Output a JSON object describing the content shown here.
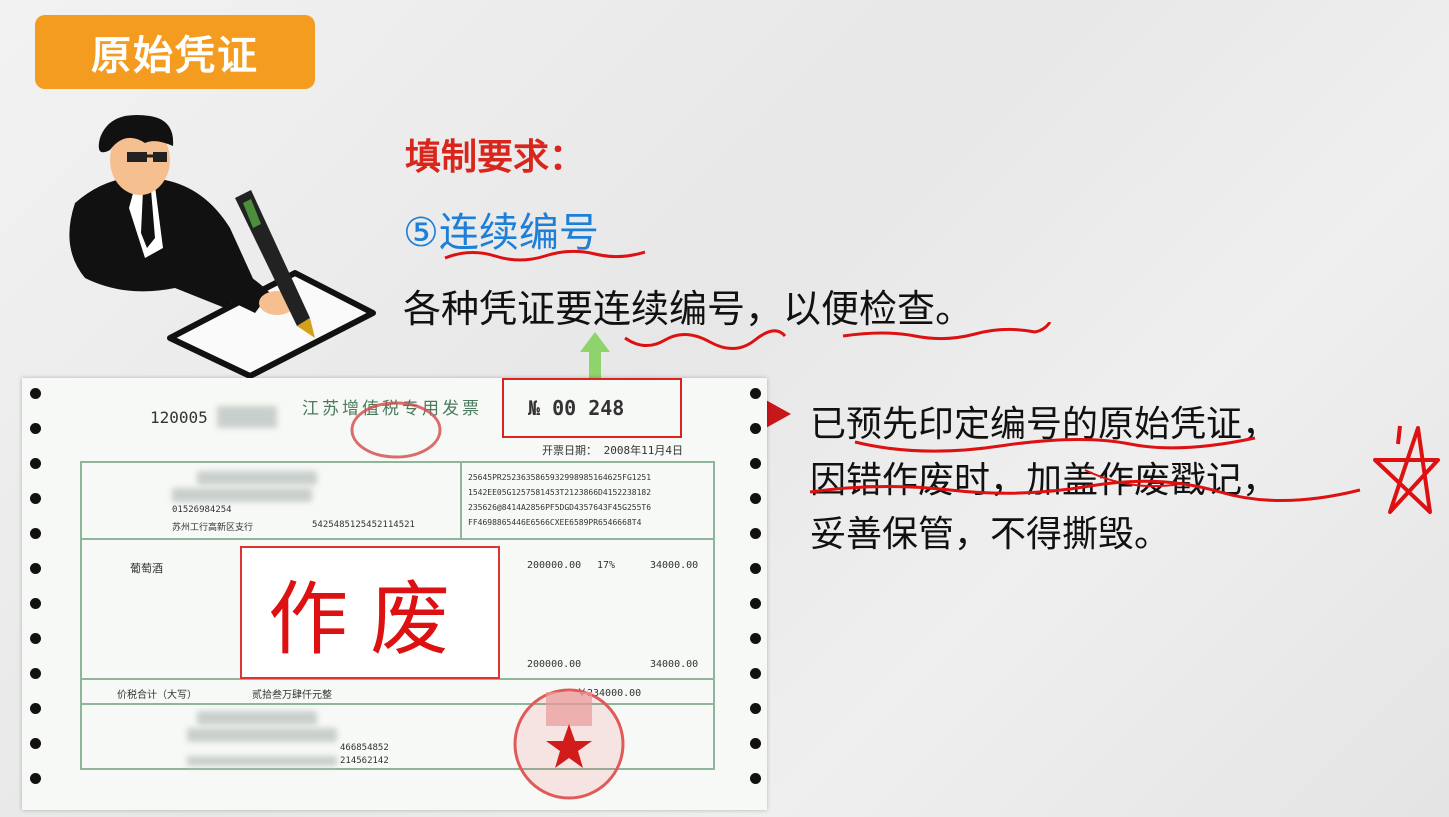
{
  "badge": {
    "label": "原始凭证"
  },
  "requirements": {
    "heading": "填制要求：",
    "item_number": "⑤",
    "item_title": "连续编号",
    "sentence_a": "各种凭证要",
    "sentence_b": "连续编号",
    "sentence_c": "，",
    "sentence_d": "以便检查",
    "sentence_e": "。"
  },
  "note": {
    "line1": "已预先印定编号的原始凭证，",
    "line2": "因错作废时，加盖作废戳记，",
    "line3": "妥善保管，不得撕毁。"
  },
  "invoice": {
    "code": "120005",
    "title": "江苏增值税专用发票",
    "number_prefix": "№",
    "number_value": "00  248",
    "issue_date_label": "开票日期：",
    "issue_date": "2008年11月4日",
    "void_stamp": "作废",
    "product": "葡萄酒",
    "amount": "200000.00",
    "tax_rate": "17%",
    "tax": "34000.00",
    "total_amount": "200000.00",
    "total_tax": "34000.00",
    "total_words_label": "价税合计（大写）",
    "total_words": "贰拾叁万肆仟元整",
    "total_small": "￥234000.00",
    "cipher_lines": [
      "25645PR2523635865932998985164625FG1251",
      "1542EE05G1257581453T2123866D4152238182",
      "235626@8414A2856PF5DGD4357643F45G255T6",
      "FF4698865446E6566CXEE6589PR6546668T4"
    ],
    "buyer_account": "5425485125452114521",
    "buyer_bank": "苏州工行高新区支行",
    "buyer_tax": "01526984254",
    "seller_phone": "466854852",
    "seller_account": "214562142"
  },
  "colors": {
    "badge_bg": "#f39c1f",
    "heading_red": "#d9261c",
    "item_blue": "#1e7fd8",
    "annotation_red": "#d11"
  }
}
